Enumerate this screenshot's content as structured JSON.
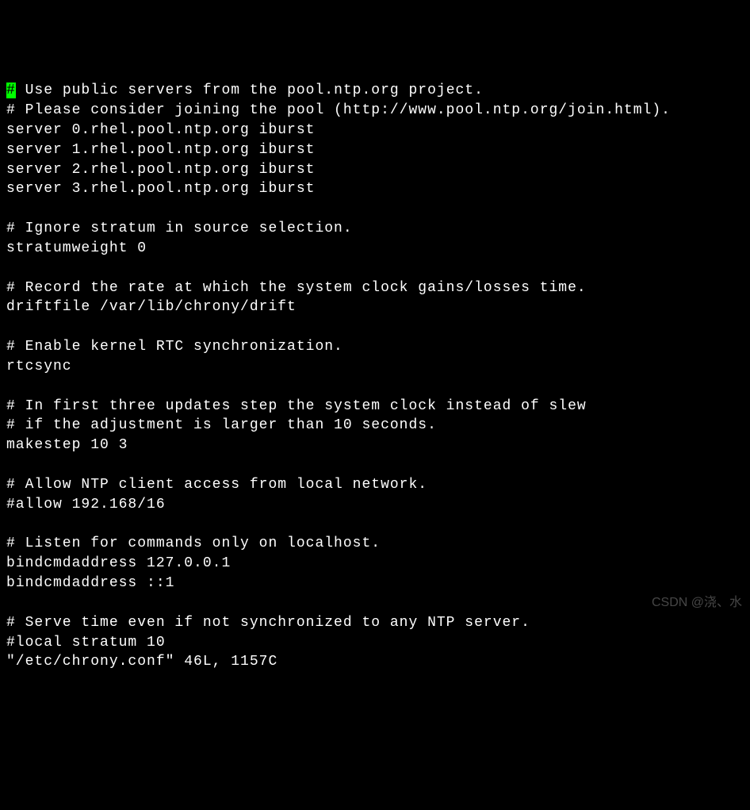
{
  "editor": {
    "cursor_char": "#",
    "lines": [
      " Use public servers from the pool.ntp.org project.",
      "# Please consider joining the pool (http://www.pool.ntp.org/join.html).",
      "server 0.rhel.pool.ntp.org iburst",
      "server 1.rhel.pool.ntp.org iburst",
      "server 2.rhel.pool.ntp.org iburst",
      "server 3.rhel.pool.ntp.org iburst",
      "",
      "# Ignore stratum in source selection.",
      "stratumweight 0",
      "",
      "# Record the rate at which the system clock gains/losses time.",
      "driftfile /var/lib/chrony/drift",
      "",
      "# Enable kernel RTC synchronization.",
      "rtcsync",
      "",
      "# In first three updates step the system clock instead of slew",
      "# if the adjustment is larger than 10 seconds.",
      "makestep 10 3",
      "",
      "# Allow NTP client access from local network.",
      "#allow 192.168/16",
      "",
      "# Listen for commands only on localhost.",
      "bindcmdaddress 127.0.0.1",
      "bindcmdaddress ::1",
      "",
      "# Serve time even if not synchronized to any NTP server.",
      "#local stratum 10"
    ],
    "status_line": "\"/etc/chrony.conf\" 46L, 1157C"
  },
  "watermark": "CSDN @浇、水"
}
